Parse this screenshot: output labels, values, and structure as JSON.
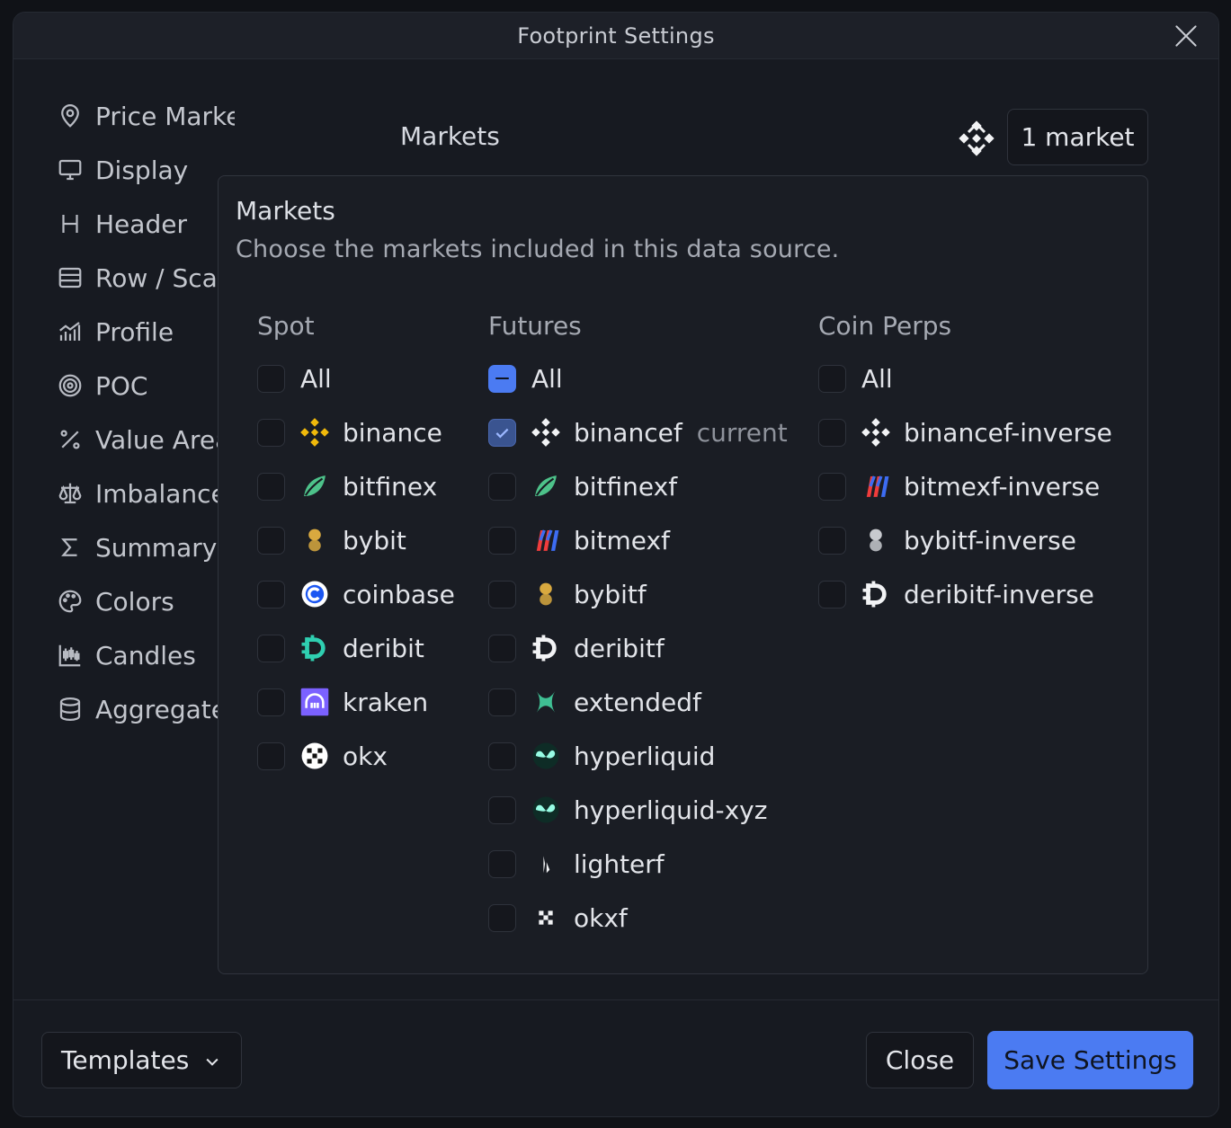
{
  "dialog": {
    "title": "Footprint Settings"
  },
  "sidebar": {
    "items": [
      {
        "label": "Price Marker",
        "icon": "map-pin-icon"
      },
      {
        "label": "Display",
        "icon": "monitor-icon"
      },
      {
        "label": "Header",
        "icon": "heading-icon"
      },
      {
        "label": "Row / Scale",
        "icon": "rows-icon"
      },
      {
        "label": "Profile",
        "icon": "bar-chart-icon"
      },
      {
        "label": "POC",
        "icon": "target-icon"
      },
      {
        "label": "Value Area",
        "icon": "percent-icon"
      },
      {
        "label": "Imbalance",
        "icon": "scale-icon"
      },
      {
        "label": "Summary",
        "icon": "sigma-icon"
      },
      {
        "label": "Colors",
        "icon": "palette-icon"
      },
      {
        "label": "Candles",
        "icon": "candles-icon"
      },
      {
        "label": "Aggregate",
        "icon": "database-icon"
      }
    ]
  },
  "markets": {
    "label": "Markets",
    "button_label": "1 market",
    "selected_logo": "binance-logo-icon"
  },
  "popup": {
    "title": "Markets",
    "subtitle": "Choose the markets included in this data source.",
    "all_label": "All",
    "current_label": "current",
    "columns": [
      {
        "heading": "Spot",
        "all_state": "unchecked",
        "items": [
          {
            "label": "binance",
            "logo": "binance-logo-icon",
            "checked": false
          },
          {
            "label": "bitfinex",
            "logo": "bitfinex-logo-icon",
            "checked": false
          },
          {
            "label": "bybit",
            "logo": "bybit-logo-icon",
            "checked": false
          },
          {
            "label": "coinbase",
            "logo": "coinbase-logo-icon",
            "checked": false
          },
          {
            "label": "deribit",
            "logo": "deribit-logo-icon",
            "checked": false
          },
          {
            "label": "kraken",
            "logo": "kraken-logo-icon",
            "checked": false
          },
          {
            "label": "okx",
            "logo": "okx-logo-icon",
            "checked": false
          }
        ]
      },
      {
        "heading": "Futures",
        "all_state": "indeterminate",
        "items": [
          {
            "label": "binancef",
            "logo": "binance-logo-icon",
            "checked": true,
            "current": true
          },
          {
            "label": "bitfinexf",
            "logo": "bitfinex-logo-icon",
            "checked": false
          },
          {
            "label": "bitmexf",
            "logo": "bitmex-logo-icon",
            "checked": false
          },
          {
            "label": "bybitf",
            "logo": "bybit-logo-icon",
            "checked": false
          },
          {
            "label": "deribitf",
            "logo": "deribit-logo-icon",
            "checked": false
          },
          {
            "label": "extendedf",
            "logo": "extended-logo-icon",
            "checked": false
          },
          {
            "label": "hyperliquid",
            "logo": "hyperliquid-logo-icon",
            "checked": false
          },
          {
            "label": "hyperliquid-xyz",
            "logo": "hyperliquid-logo-icon",
            "checked": false
          },
          {
            "label": "lighterf",
            "logo": "lighter-logo-icon",
            "checked": false
          },
          {
            "label": "okxf",
            "logo": "okx-logo-icon",
            "checked": false
          }
        ]
      },
      {
        "heading": "Coin Perps",
        "all_state": "unchecked",
        "items": [
          {
            "label": "binancef-inverse",
            "logo": "binance-logo-icon",
            "checked": false
          },
          {
            "label": "bitmexf-inverse",
            "logo": "bitmex-logo-icon",
            "checked": false
          },
          {
            "label": "bybitf-inverse",
            "logo": "bybit-logo-icon",
            "checked": false
          },
          {
            "label": "deribitf-inverse",
            "logo": "deribit-logo-icon",
            "checked": false
          }
        ]
      }
    ]
  },
  "footer": {
    "templates_label": "Templates",
    "close_label": "Close",
    "save_label": "Save Settings"
  },
  "colors": {
    "accent": "#4b7bf2",
    "background": "#171a21"
  }
}
